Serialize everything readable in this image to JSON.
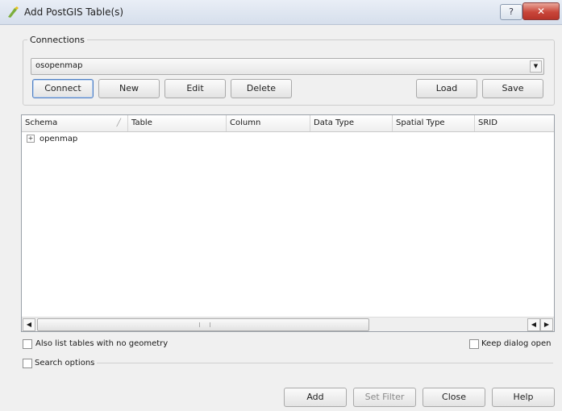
{
  "window": {
    "title": "Add PostGIS Table(s)",
    "help_symbol": "?",
    "close_symbol": "✕"
  },
  "connections": {
    "group_label": "Connections",
    "selected": "osopenmap",
    "buttons": {
      "connect": "Connect",
      "new": "New",
      "edit": "Edit",
      "delete": "Delete",
      "load": "Load",
      "save": "Save"
    }
  },
  "table": {
    "columns": [
      "Schema",
      "Table",
      "Column",
      "Data Type",
      "Spatial Type",
      "SRID"
    ],
    "rows": [
      {
        "expander": "+",
        "schema": "openmap"
      }
    ],
    "scroll_left": "◀",
    "scroll_right": "▶"
  },
  "options": {
    "no_geometry_label": "Also list tables with no geometry",
    "keep_open_label": "Keep dialog open",
    "search_options_label": "Search options"
  },
  "footer": {
    "add": "Add",
    "set_filter": "Set Filter",
    "close": "Close",
    "help": "Help"
  },
  "colors": {
    "accent": "#4f7ec2",
    "close_red": "#c9463a",
    "window_bg": "#f0f0f0"
  }
}
